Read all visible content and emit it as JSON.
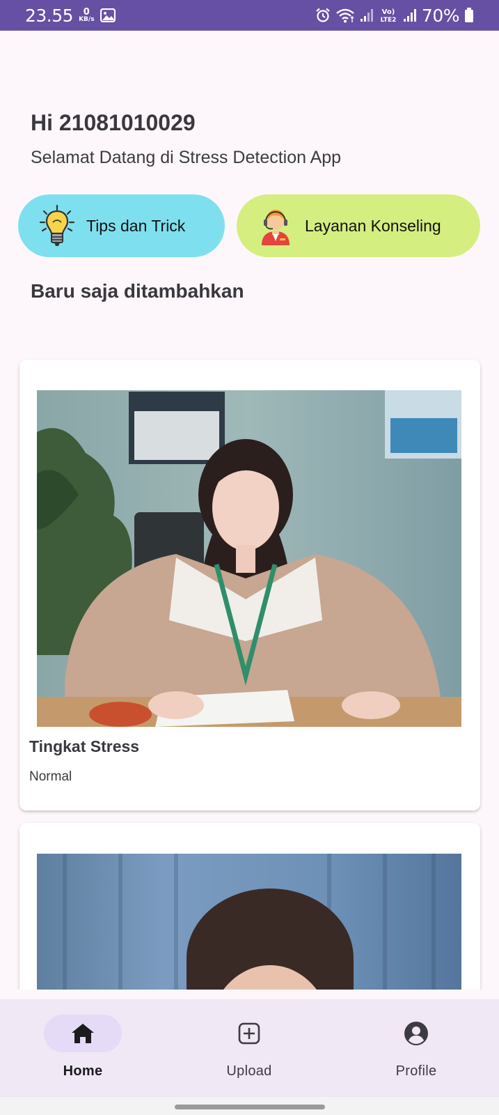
{
  "status_bar": {
    "time": "23.55",
    "net_speed_value": "0",
    "net_speed_unit": "KB/s",
    "battery": "70%"
  },
  "header": {
    "greeting": "Hi 21081010029",
    "welcome": "Selamat Datang di Stress Detection App"
  },
  "quick_actions": {
    "tips_label": "Tips dan Trick",
    "tips_icon": "lightbulb-icon",
    "konseling_label": "Layanan Konseling",
    "konseling_icon": "counselor-icon"
  },
  "section": {
    "title": "Baru saja ditambahkan"
  },
  "cards": [
    {
      "title": "Tingkat Stress",
      "value": "Normal"
    }
  ],
  "nav": {
    "home": "Home",
    "upload": "Upload",
    "profile": "Profile",
    "active": "home"
  },
  "colors": {
    "status_bar": "#6650a4",
    "tips_pill": "#7ee0ee",
    "konseling_pill": "#d4ee80",
    "nav_active": "#e6dbf6"
  }
}
